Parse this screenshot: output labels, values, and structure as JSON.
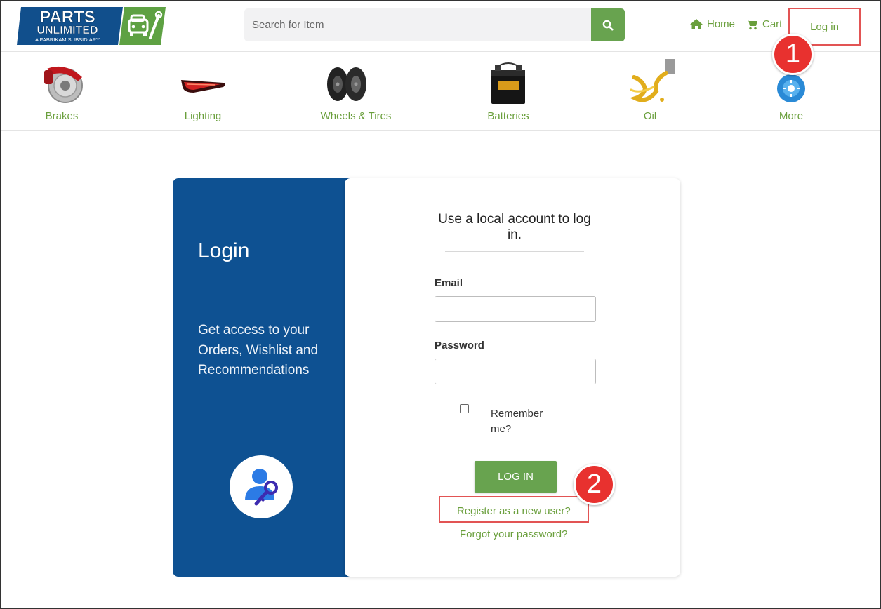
{
  "header": {
    "logo": {
      "line1": "PARTS",
      "line2": "UNLIMITED",
      "tagline": "A FABRIKAM SUBSIDIARY"
    },
    "search": {
      "placeholder": "Search for Item",
      "icon": "search-icon"
    },
    "nav": {
      "home": {
        "label": "Home",
        "icon": "home-icon"
      },
      "cart": {
        "label": "Cart",
        "icon": "cart-icon"
      },
      "login": {
        "label": "Log in"
      }
    }
  },
  "categories": [
    {
      "label": "Brakes",
      "icon": "brakes-icon"
    },
    {
      "label": "Lighting",
      "icon": "lighting-icon"
    },
    {
      "label": "Wheels & Tires",
      "icon": "wheels-tires-icon"
    },
    {
      "label": "Batteries",
      "icon": "battery-icon"
    },
    {
      "label": "Oil",
      "icon": "oil-icon"
    },
    {
      "label": "More",
      "icon": "more-icon"
    }
  ],
  "login_panel": {
    "title": "Login",
    "description": "Get access to your Orders, Wishlist and Recommendations",
    "icon": "user-key-icon"
  },
  "form": {
    "heading": "Use a local account to log in.",
    "email_label": "Email",
    "email_value": "",
    "password_label": "Password",
    "password_value": "",
    "remember_label": "Remember me?",
    "remember_checked": false,
    "submit_label": "LOG IN",
    "register_link": "Register as a new user?",
    "forgot_link": "Forgot your password?"
  },
  "annotations": {
    "step1": "1",
    "step2": "2"
  },
  "colors": {
    "brand_blue": "#0e5192",
    "accent_green": "#68a34f",
    "link_green": "#6a9f3c",
    "highlight_red": "#e25454",
    "badge_red": "#e8312f"
  }
}
